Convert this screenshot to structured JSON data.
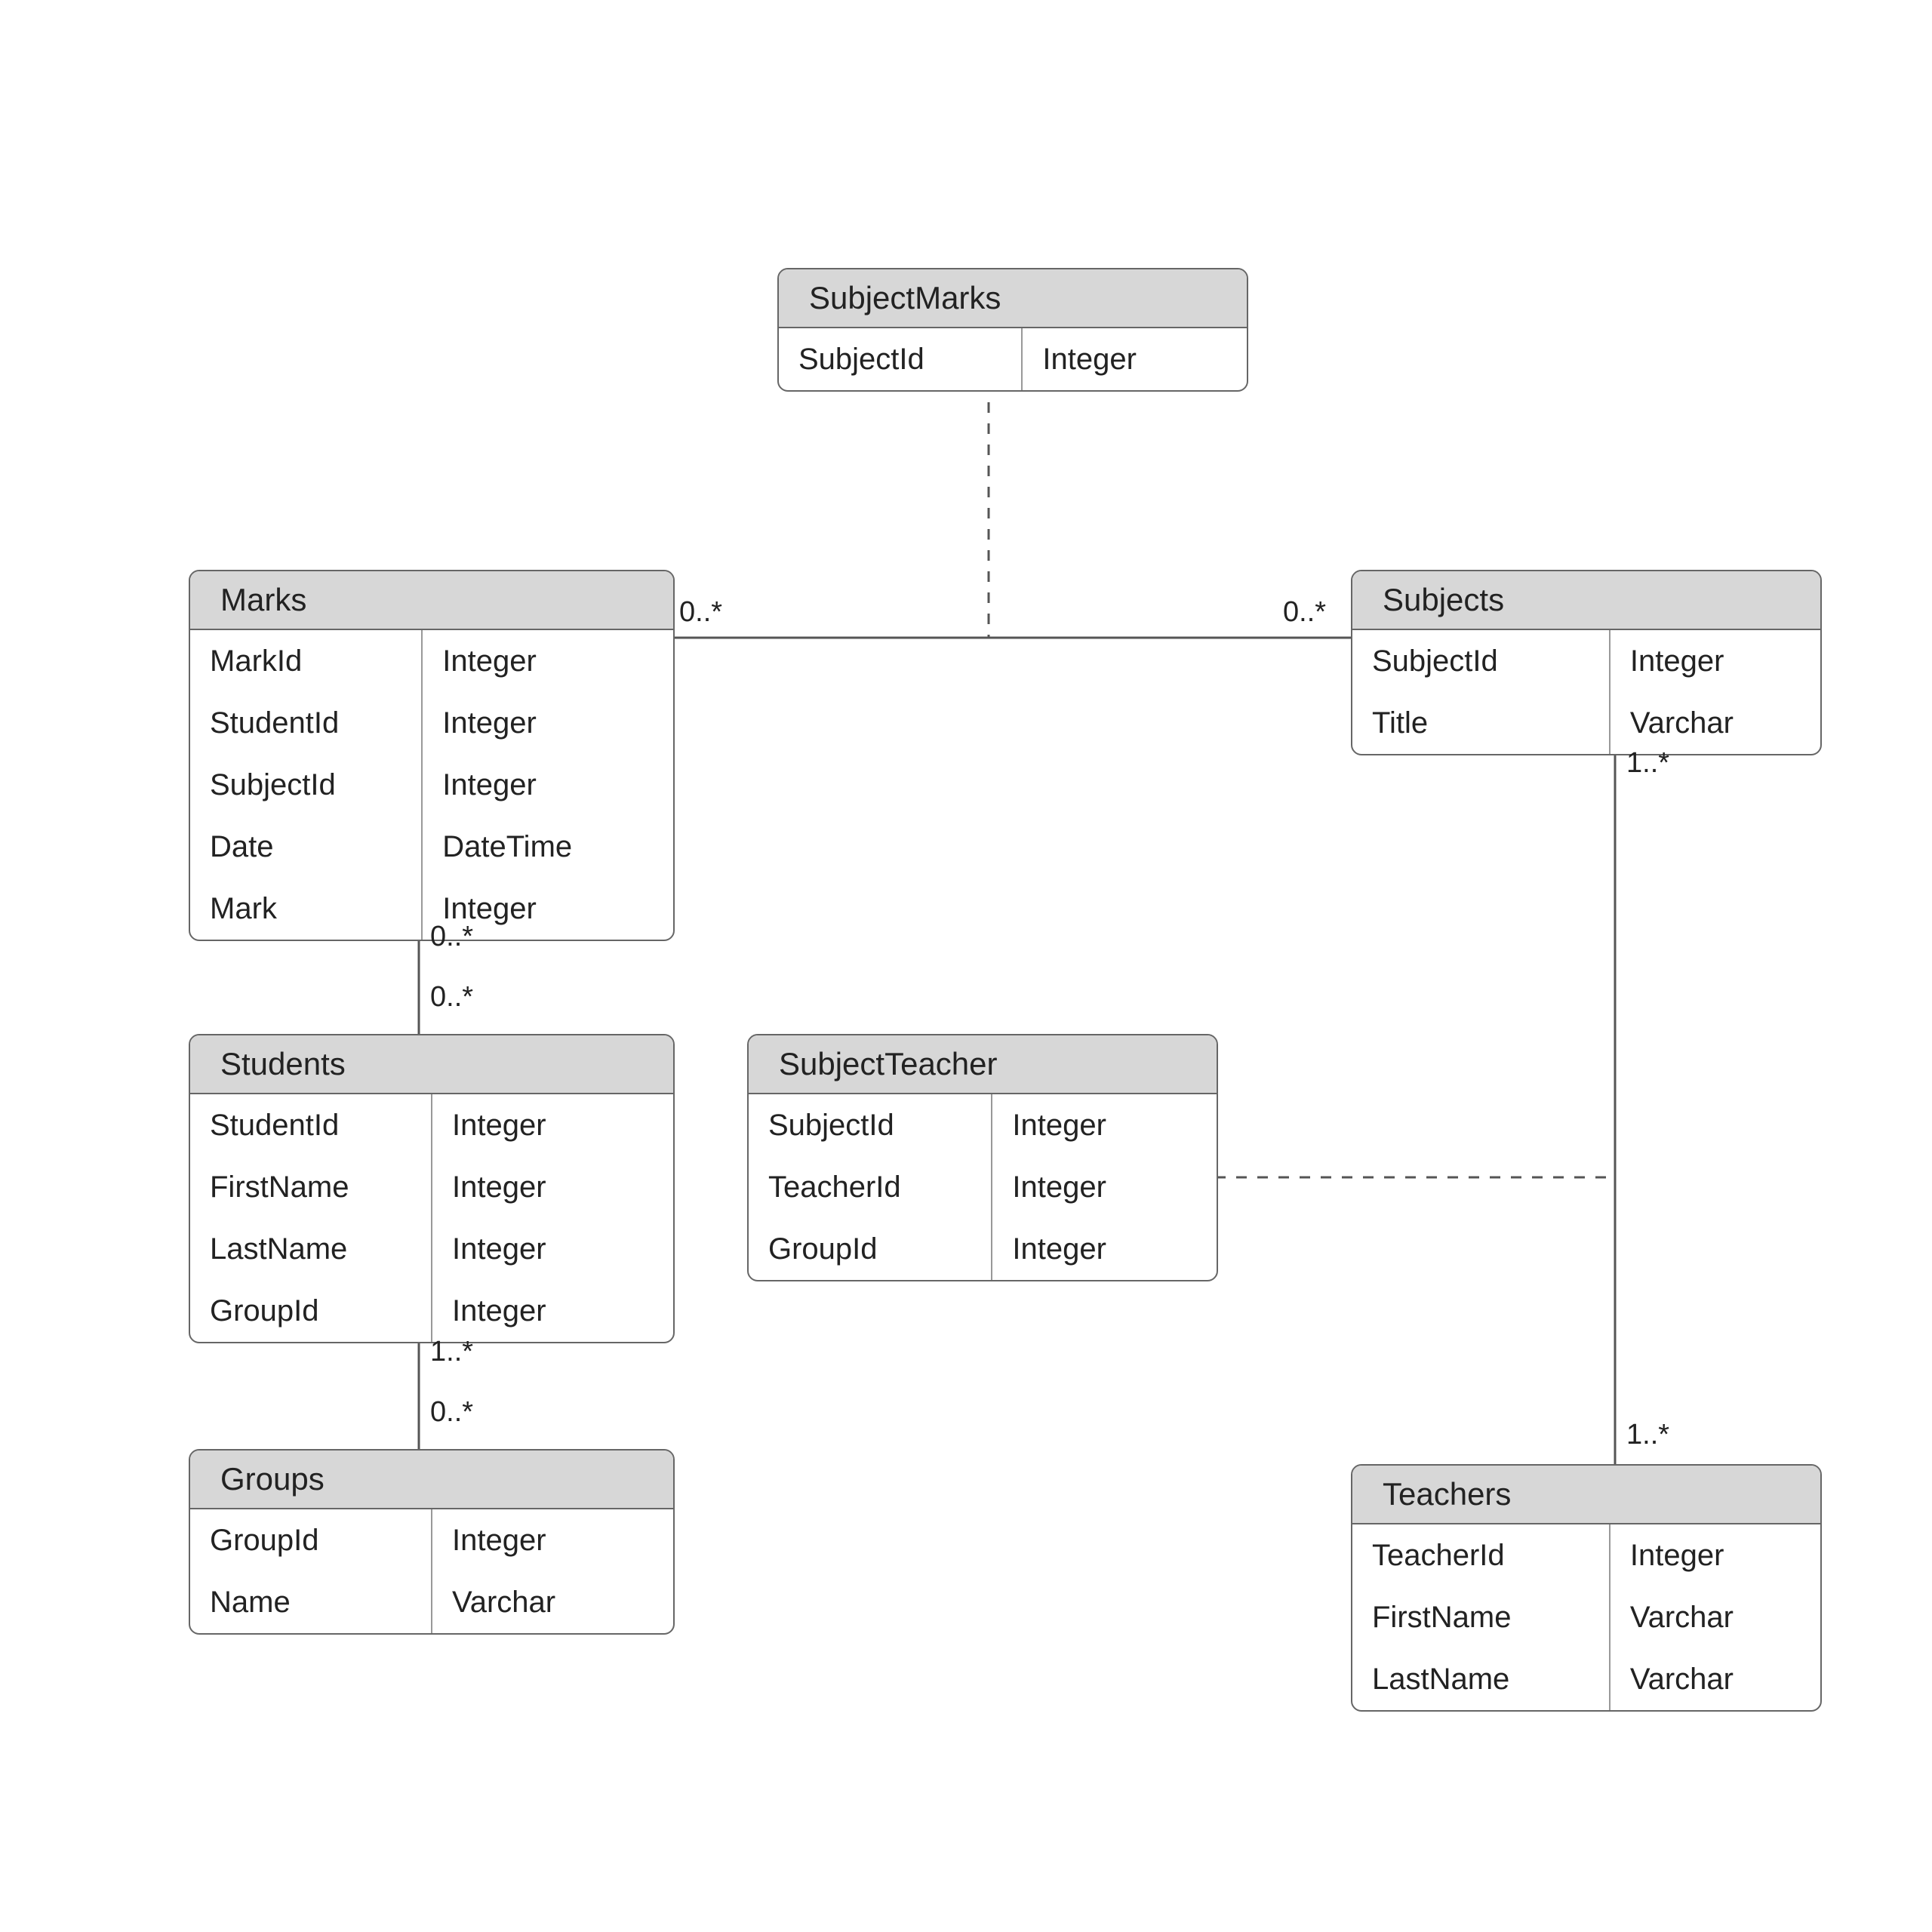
{
  "entities": {
    "subjectMarks": {
      "title": "SubjectMarks",
      "fields": [
        {
          "name": "SubjectId",
          "type": "Integer"
        }
      ]
    },
    "marks": {
      "title": "Marks",
      "fields": [
        {
          "name": "MarkId",
          "type": "Integer"
        },
        {
          "name": "StudentId",
          "type": "Integer"
        },
        {
          "name": "SubjectId",
          "type": "Integer"
        },
        {
          "name": "Date",
          "type": "DateTime"
        },
        {
          "name": "Mark",
          "type": "Integer"
        }
      ]
    },
    "subjects": {
      "title": "Subjects",
      "fields": [
        {
          "name": "SubjectId",
          "type": "Integer"
        },
        {
          "name": "Title",
          "type": "Varchar"
        }
      ]
    },
    "students": {
      "title": "Students",
      "fields": [
        {
          "name": "StudentId",
          "type": "Integer"
        },
        {
          "name": "FirstName",
          "type": "Integer"
        },
        {
          "name": "LastName",
          "type": "Integer"
        },
        {
          "name": "GroupId",
          "type": "Integer"
        }
      ]
    },
    "subjectTeacher": {
      "title": "SubjectTeacher",
      "fields": [
        {
          "name": "SubjectId",
          "type": "Integer"
        },
        {
          "name": "TeacherId",
          "type": "Integer"
        },
        {
          "name": "GroupId",
          "type": "Integer"
        }
      ]
    },
    "groups": {
      "title": "Groups",
      "fields": [
        {
          "name": "GroupId",
          "type": "Integer"
        },
        {
          "name": "Name",
          "type": "Varchar"
        }
      ]
    },
    "teachers": {
      "title": "Teachers",
      "fields": [
        {
          "name": "TeacherId",
          "type": "Integer"
        },
        {
          "name": "FirstName",
          "type": "Varchar"
        },
        {
          "name": "LastName",
          "type": "Varchar"
        }
      ]
    }
  },
  "multiplicities": {
    "marks_subjects_left": "0..*",
    "marks_subjects_right": "0..*",
    "marks_students_top": "0..*",
    "marks_students_bottom": "0..*",
    "students_groups_top": "1..*",
    "students_groups_bottom": "0..*",
    "subjects_teachers_top": "1..*",
    "subjects_teachers_bottom": "1..*"
  }
}
